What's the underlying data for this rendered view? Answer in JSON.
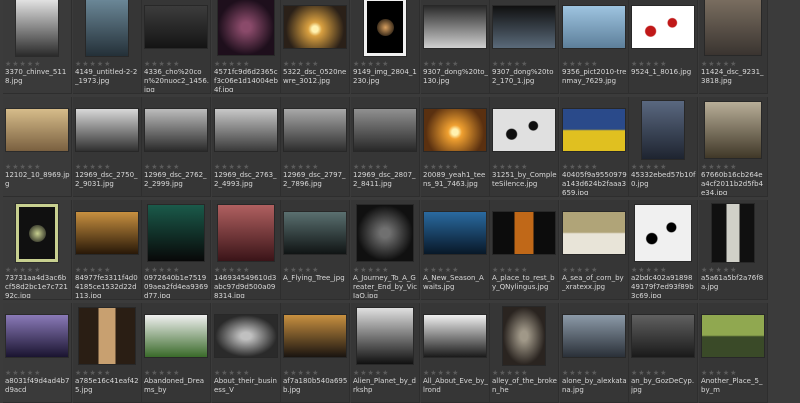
{
  "rating_stars": "★★★★★",
  "thumbnails": [
    {
      "label": "3370_chinve_5118.jpg",
      "img": "tree-bw",
      "colors": [
        "#e8e8e8",
        "#2a2a2a"
      ],
      "shape": "portrait"
    },
    {
      "label": "4149_untitled-2-2_1973.jpg",
      "img": "lake",
      "colors": [
        "#6d8a9a",
        "#243038"
      ],
      "shape": "portrait"
    },
    {
      "label": "4336_cho%20con%20nuoc2_1456.jpg",
      "img": "dark-landscape",
      "colors": [
        "#3c3c3c",
        "#141414"
      ],
      "shape": "landscape"
    },
    {
      "label": "4571fc9d6d2365cf3c06e1d14004eb4f.jpg",
      "img": "corridor",
      "colors": [
        "#8a4a6a",
        "#1e0f1c"
      ],
      "shape": "square"
    },
    {
      "label": "5322_dsc_0520newre_3012.jpg",
      "img": "sunset-field",
      "colors": [
        "#d9a040",
        "#2a2018"
      ],
      "shape": "landscape"
    },
    {
      "label": "9149_img_2804_1230.jpg",
      "img": "rose-framed",
      "colors": [
        "#f0f0f0",
        "#000000"
      ],
      "shape": "portrait"
    },
    {
      "label": "9307_dong%20to_130.jpg",
      "img": "storm-sea",
      "colors": [
        "#2a2a2a",
        "#d0d0d0"
      ],
      "shape": "landscape"
    },
    {
      "label": "9307_dong%20to2_170_1.jpg",
      "img": "night-sea",
      "colors": [
        "#101010",
        "#5a6a7a"
      ],
      "shape": "landscape"
    },
    {
      "label": "9356_pict2010-trenmay_7629.jpg",
      "img": "sky",
      "colors": [
        "#9ec4e0",
        "#5d7f9a"
      ],
      "shape": "landscape"
    },
    {
      "label": "9524_1_8016.jpg",
      "img": "poppies",
      "colors": [
        "#ffffff",
        "#c01818"
      ],
      "shape": "landscape"
    },
    {
      "label": "11424_dsc_9231_3818.jpg",
      "img": "building",
      "colors": [
        "#7a6e60",
        "#3a3430"
      ],
      "shape": "square"
    },
    {
      "label": "12102_10_8969.jpg",
      "img": "sepia",
      "colors": [
        "#d6bc8a",
        "#7a6040"
      ],
      "shape": "landscape"
    },
    {
      "label": "12969_dsc_2750_2_9031.jpg",
      "img": "snow-trees",
      "colors": [
        "#d8d8d8",
        "#303030"
      ],
      "shape": "landscape"
    },
    {
      "label": "12969_dsc_2762_2_2999.jpg",
      "img": "snow-trees",
      "colors": [
        "#bcbcbc",
        "#2a2a2a"
      ],
      "shape": "landscape"
    },
    {
      "label": "12969_dsc_2763_2_4993.jpg",
      "img": "snow-trees",
      "colors": [
        "#c8c8c8",
        "#3a3a3a"
      ],
      "shape": "landscape"
    },
    {
      "label": "12969_dsc_2797_2_7896.jpg",
      "img": "river",
      "colors": [
        "#a8a8a8",
        "#2e2e2e"
      ],
      "shape": "landscape"
    },
    {
      "label": "12969_dsc_2807_2_8411.jpg",
      "img": "snow-trees",
      "colors": [
        "#909090",
        "#282828"
      ],
      "shape": "landscape"
    },
    {
      "label": "20089_yeah1_teens_91_7463.jpg",
      "img": "sun-sea",
      "colors": [
        "#f0a030",
        "#5a3010"
      ],
      "shape": "landscape"
    },
    {
      "label": "31251_by_CompleteSilence.jpg",
      "img": "flowers-dark",
      "colors": [
        "#e0e0e0",
        "#101010"
      ],
      "shape": "landscape"
    },
    {
      "label": "40405f9a9550979a143d624b2faaa3659.jpg",
      "img": "field-sunset",
      "colors": [
        "#2a4a8a",
        "#e0c020"
      ],
      "shape": "landscape"
    },
    {
      "label": "45332ebed57b10f0.jpg",
      "img": "window-figure",
      "colors": [
        "#5a6880",
        "#1e2430"
      ],
      "shape": "portrait"
    },
    {
      "label": "67660b16cb264ea4cf2011b2d5fb4e34.jpg",
      "img": "sepia-sketch",
      "colors": [
        "#b8ae98",
        "#403828"
      ],
      "shape": "square"
    },
    {
      "label": "73731aa4d3ac6bcf58d2bc1e7c72192c.jpg",
      "img": "tree-framed",
      "colors": [
        "#c8d090",
        "#101010"
      ],
      "shape": "portrait"
    },
    {
      "label": "84977fe3311f4d04185ce1532d22d113.jpg",
      "img": "church",
      "colors": [
        "#c89040",
        "#281808"
      ],
      "shape": "landscape"
    },
    {
      "label": "0972640b1e751909aea2fd4ea9369d77.jpg",
      "img": "swirl",
      "colors": [
        "#1a5a4a",
        "#080808"
      ],
      "shape": "square"
    },
    {
      "label": "146934549610d3abc97d9d500a098314.jpg",
      "img": "flower-red",
      "colors": [
        "#b06060",
        "#3a1418"
      ],
      "shape": "square"
    },
    {
      "label": "A_Flying_Tree_jpg",
      "img": "flying-tree",
      "colors": [
        "#5a7070",
        "#101414"
      ],
      "shape": "landscape"
    },
    {
      "label": "A_Journey_To_A_Greater_End_by_VicIaQ.jpg",
      "img": "forest-path",
      "colors": [
        "#707070",
        "#101010"
      ],
      "shape": "square"
    },
    {
      "label": "A_New_Season_Awaits.jpg",
      "img": "blue-forest",
      "colors": [
        "#2a6aa0",
        "#081828"
      ],
      "shape": "landscape"
    },
    {
      "label": "A_place_to_rest_by_QNylingus.jpg",
      "img": "dark-window",
      "colors": [
        "#c06818",
        "#0c0c0c"
      ],
      "shape": "landscape"
    },
    {
      "label": "A_sea_of_corn_by_xratexx.jpg",
      "img": "wheat",
      "colors": [
        "#b0a478",
        "#e8e4d8"
      ],
      "shape": "landscape"
    },
    {
      "label": "a2bdc402a9189849179f7ed93f89b3c69.jpg",
      "img": "blossom",
      "colors": [
        "#f0f0f0",
        "#000000"
      ],
      "shape": "square"
    },
    {
      "label": "a5a61a5bf2a76f8a.jpg",
      "img": "doorway",
      "colors": [
        "#d0d0c8",
        "#101010"
      ],
      "shape": "portrait"
    },
    {
      "label": "a8031f49d4ad4b7d9acd",
      "img": "lightning",
      "colors": [
        "#8a7ab8",
        "#1a1430"
      ],
      "shape": "landscape"
    },
    {
      "label": "a785e16c41eaf425.jpg",
      "img": "room-window",
      "colors": [
        "#c8a070",
        "#2a1e14"
      ],
      "shape": "square"
    },
    {
      "label": "Abandoned_Dreams_by",
      "img": "guitar",
      "colors": [
        "#f0f0f0",
        "#3a6a2a"
      ],
      "shape": "landscape"
    },
    {
      "label": "About_their_business_V",
      "img": "hall",
      "colors": [
        "#c0c0c0",
        "#2a2a2a"
      ],
      "shape": "landscape"
    },
    {
      "label": "af7a180b540a695b.jpg",
      "img": "shop",
      "colors": [
        "#c89040",
        "#1a1410"
      ],
      "shape": "landscape"
    },
    {
      "label": "Alien_Planet_by_drkshp",
      "img": "snow-trees",
      "colors": [
        "#e0e0e0",
        "#101010"
      ],
      "shape": "square"
    },
    {
      "label": "All_About_Eve_by_lrond",
      "img": "tree-bw",
      "colors": [
        "#f0f0f0",
        "#1a1a1a"
      ],
      "shape": "landscape"
    },
    {
      "label": "alley_of_the_broken_he",
      "img": "alley",
      "colors": [
        "#a09888",
        "#2a2420"
      ],
      "shape": "portrait"
    },
    {
      "label": "alone_by_alexkatana.jpg",
      "img": "lone-tree",
      "colors": [
        "#8c9aa8",
        "#2a3038"
      ],
      "shape": "landscape"
    },
    {
      "label": "an_by_GozDeCyp.jpg",
      "img": "arch",
      "colors": [
        "#606060",
        "#1a1a1a"
      ],
      "shape": "landscape"
    },
    {
      "label": "Another_Place_5_by_m",
      "img": "hill-tree",
      "colors": [
        "#90a850",
        "#3a4a28"
      ],
      "shape": "landscape"
    }
  ]
}
